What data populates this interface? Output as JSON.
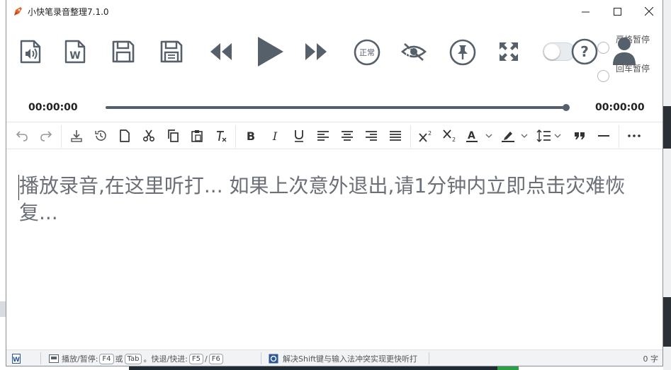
{
  "window": {
    "title": "小快笔录音整理7.1.0"
  },
  "toolbar": {
    "items": [
      {
        "icon": "audio-file-icon"
      },
      {
        "icon": "word-file-icon"
      },
      {
        "icon": "save-icon"
      },
      {
        "icon": "save-as-icon"
      },
      {
        "icon": "rewind-icon"
      },
      {
        "icon": "play-icon"
      },
      {
        "icon": "fast-forward-icon"
      },
      {
        "icon": "speed-icon",
        "label": "正常"
      },
      {
        "icon": "hide-icon"
      },
      {
        "icon": "pin-icon"
      },
      {
        "icon": "fullscreen-icon"
      },
      {
        "icon": "toggle-switch"
      },
      {
        "icon": "help-icon"
      }
    ],
    "radio_strict_pause": "严格暂停",
    "radio_enter_pause": "回车暂停"
  },
  "player": {
    "current_time": "00:00:00",
    "total_time": "00:00:00",
    "progress": 1.0
  },
  "editor": {
    "placeholder": "播放录音,在这里听打... 如果上次意外退出,请1分钟内立即点击灾难恢复..."
  },
  "statusbar": {
    "play_pause_label": "播放/暂停:",
    "key_f4": "F4",
    "or_text": "或",
    "key_tab": "Tab",
    "seek_label": "。快退/快进:",
    "key_f5": "F5",
    "slash": "/",
    "key_f6": "F6",
    "tip": "解决Shift键与输入法冲突实现更快听打",
    "char_count": "0 字"
  },
  "colors": {
    "accent": "#56606b",
    "brand_orange": "#e8632b"
  }
}
